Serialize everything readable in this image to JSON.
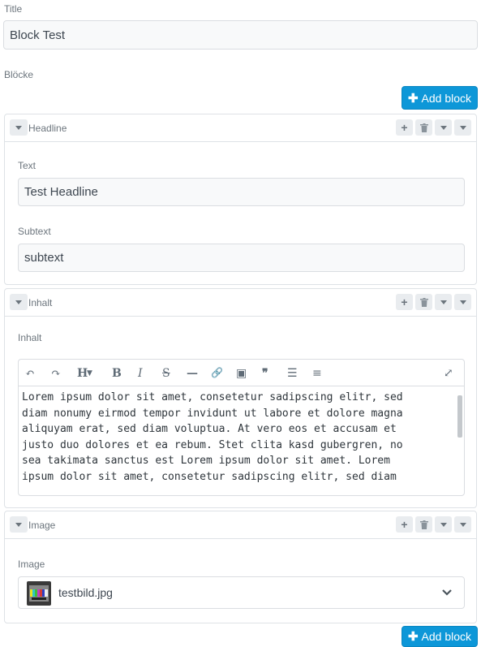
{
  "title_field": {
    "label": "Title",
    "value": "Block Test"
  },
  "bloecke_label": "Blöcke",
  "add_block_label": "Add block",
  "blocks": [
    {
      "type": "Headline",
      "fields": [
        {
          "label": "Text",
          "value": "Test Headline"
        },
        {
          "label": "Subtext",
          "value": "subtext"
        }
      ]
    },
    {
      "type": "Inhalt",
      "field_label": "Inhalt",
      "toolbar": {
        "undo": "↶",
        "redo": "↷",
        "heading": "H",
        "bold": "B",
        "italic": "I",
        "strike": "S",
        "hr": "—",
        "link": "🔗",
        "image": "▣",
        "quote": "❞",
        "ul": "☰",
        "ol": "≡",
        "fullscreen": "⤢"
      },
      "content_lines": [
        "Lorem ipsum dolor sit amet, consetetur sadipscing elitr, sed",
        "diam nonumy eirmod tempor invidunt ut labore et dolore magna",
        "aliquyam erat, sed diam voluptua. At vero eos et accusam et",
        "justo duo dolores et ea rebum. Stet clita kasd gubergren, no",
        "sea takimata sanctus est Lorem ipsum dolor sit amet. Lorem",
        "ipsum dolor sit amet, consetetur sadipscing elitr, sed diam"
      ]
    },
    {
      "type": "Image",
      "field_label": "Image",
      "selected_file": "testbild.jpg"
    }
  ],
  "colors": {
    "accent": "#0d97d8",
    "border": "#dee2e6"
  }
}
